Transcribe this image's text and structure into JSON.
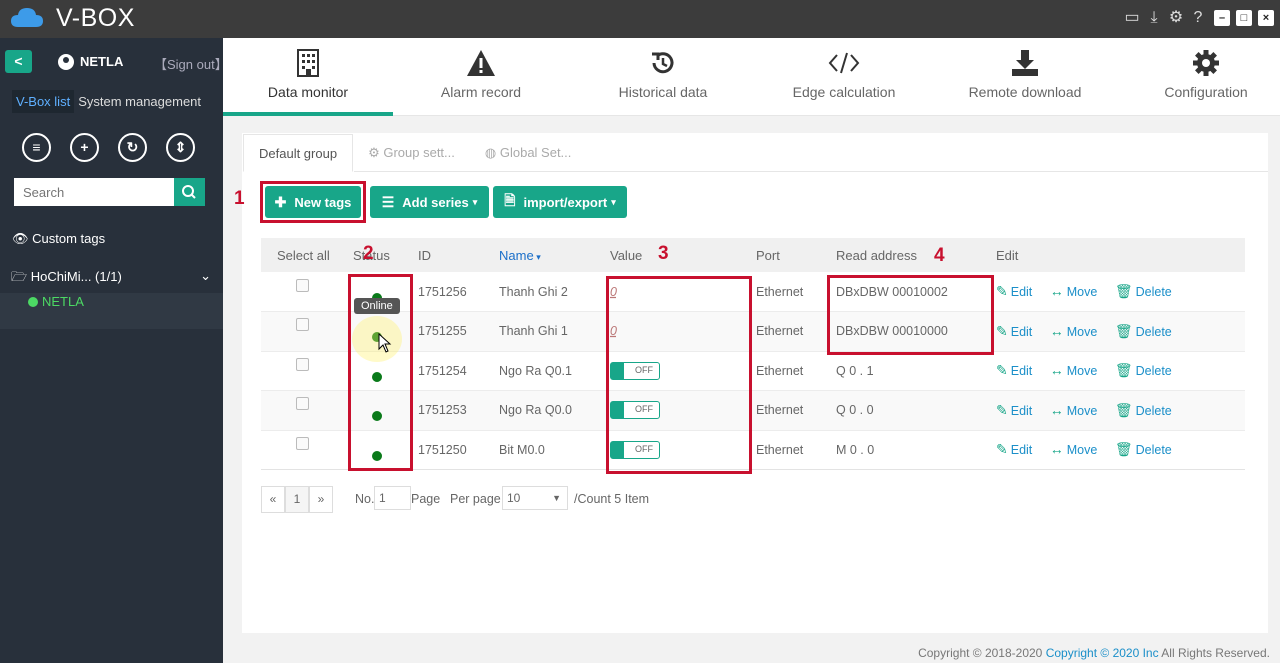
{
  "titlebar": {
    "app_name": "V-BOX",
    "icons": [
      "monitor-icon",
      "download-icon",
      "gear-icon",
      "help-icon"
    ],
    "window_buttons": [
      "–",
      "□",
      "×"
    ]
  },
  "sidebar": {
    "back": "<",
    "user": "NETLA",
    "sign_out": "【Sign out】",
    "tabs": [
      "V-Box list",
      "System management"
    ],
    "round_buttons": [
      "list-icon",
      "plus-icon",
      "refresh-icon",
      "sort-icon"
    ],
    "search_placeholder": "Search",
    "custom_tags": "Custom tags",
    "group": "HoChiMi...  (1/1)",
    "device": "NETLA"
  },
  "nav": {
    "items": [
      {
        "label": "Data monitor",
        "icon": "building-icon"
      },
      {
        "label": "Alarm record",
        "icon": "warning-icon"
      },
      {
        "label": "Historical data",
        "icon": "history-icon"
      },
      {
        "label": "Edge calculation",
        "icon": "code-icon"
      },
      {
        "label": "Remote download",
        "icon": "download-icon"
      },
      {
        "label": "Configuration",
        "icon": "gear-icon"
      }
    ]
  },
  "tabs": [
    "Default group",
    "Group sett...",
    "Global Set..."
  ],
  "toolbar": {
    "new_tags": "New tags",
    "add_series": "Add series",
    "import_export": "import/export"
  },
  "table": {
    "headers": {
      "select_all": "Select all",
      "status": "Status",
      "id": "ID",
      "name": "Name",
      "value": "Value",
      "port": "Port",
      "read_address": "Read address",
      "edit": "Edit"
    },
    "rows": [
      {
        "id": "1751256",
        "name": "Thanh Ghi 2",
        "value": "0",
        "value_type": "number",
        "port": "Ethernet",
        "address": "DBxDBW 00010002"
      },
      {
        "id": "1751255",
        "name": "Thanh Ghi 1",
        "value": "0",
        "value_type": "number",
        "port": "Ethernet",
        "address": "DBxDBW 00010000"
      },
      {
        "id": "1751254",
        "name": "Ngo Ra Q0.1",
        "value": "OFF",
        "value_type": "switch",
        "port": "Ethernet",
        "address": "Q 0 . 1"
      },
      {
        "id": "1751253",
        "name": "Ngo Ra Q0.0",
        "value": "OFF",
        "value_type": "switch",
        "port": "Ethernet",
        "address": "Q 0 . 0"
      },
      {
        "id": "1751250",
        "name": "Bit M0.0",
        "value": "OFF",
        "value_type": "switch",
        "port": "Ethernet",
        "address": "M 0 . 0"
      }
    ],
    "actions": [
      "Edit",
      "Move",
      "Delete"
    ],
    "status_color": "#0a7a1a",
    "tooltip": "Online"
  },
  "annotations": [
    "1",
    "2",
    "3",
    "4"
  ],
  "pager": {
    "prev": "«",
    "page": "1",
    "next": "»",
    "no_label": "No.",
    "no_value": "1",
    "page_label": "Page",
    "per_page_label": "Per page",
    "per_page_value": "10",
    "count": "/Count 5 Item"
  },
  "footer": {
    "copyright_prefix": "Copyright © 2018-2020",
    "copyright_link": "Copyright © 2020 Inc",
    "copyright_suffix": "All Rights Reserved."
  },
  "colors": {
    "accent": "#18a689",
    "sidebar_bg": "#28303b",
    "annotation_red": "#c8102e"
  }
}
